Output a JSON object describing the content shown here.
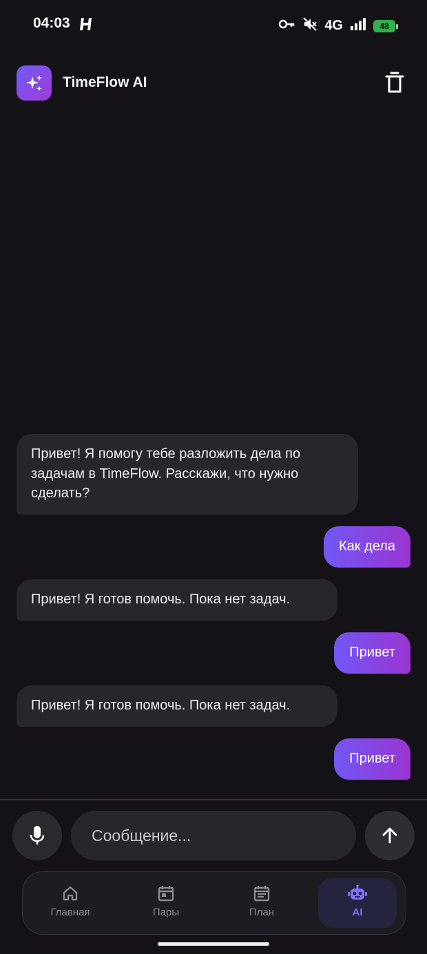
{
  "status_bar": {
    "time": "04:03",
    "network": "4G",
    "battery": "48"
  },
  "header": {
    "title": "TimeFlow AI",
    "logo_icon": "sparkles-icon",
    "delete_icon": "trash-icon"
  },
  "messages": [
    {
      "role": "ai",
      "text": "Привет! Я помогу тебе разложить дела по задачам в TimeFlow. Расскажи, что нужно сделать?"
    },
    {
      "role": "user",
      "text": "Как дела"
    },
    {
      "role": "ai",
      "text": "Привет! Я готов помочь. Пока нет задач."
    },
    {
      "role": "user",
      "text": "Привет"
    },
    {
      "role": "ai",
      "text": "Привет! Я готов помочь. Пока нет задач."
    },
    {
      "role": "user",
      "text": "Привет"
    }
  ],
  "composer": {
    "placeholder": "Сообщение...",
    "value": ""
  },
  "nav": {
    "items": [
      {
        "label": "Главная",
        "icon": "home-icon"
      },
      {
        "label": "Пары",
        "icon": "calendar-icon"
      },
      {
        "label": "План",
        "icon": "plan-icon"
      },
      {
        "label": "AI",
        "icon": "robot-icon"
      }
    ],
    "active": "AI"
  },
  "colors": {
    "background": "#141217",
    "accent": "#7f72ff",
    "user_bubble_start": "#7257f4",
    "user_bubble_end": "#9a35d2",
    "ai_bubble": "#27262b"
  }
}
